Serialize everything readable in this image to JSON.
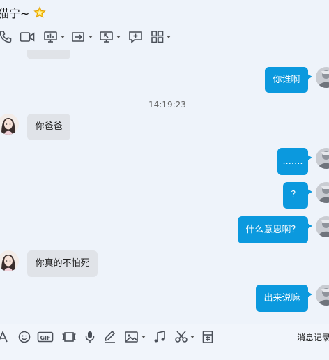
{
  "header": {
    "contact_name": "猫宁~",
    "badge_icon": "star-badge-icon"
  },
  "toolbar_top": {
    "icons": [
      "phone-icon",
      "video-icon",
      "screen-share-icon",
      "file-transfer-icon",
      "remote-desktop-icon",
      "add-chat-icon",
      "apps-grid-icon"
    ]
  },
  "chat": {
    "timestamp": "14:19:23",
    "messages": [
      {
        "side": "in",
        "text": ""
      },
      {
        "side": "out",
        "text": "你谁啊"
      },
      {
        "side": "in",
        "text": "你爸爸"
      },
      {
        "side": "out",
        "text": "......."
      },
      {
        "side": "out",
        "text": "？"
      },
      {
        "side": "out",
        "text": "什么意思啊？"
      },
      {
        "side": "in",
        "text": "你真的不怕死"
      },
      {
        "side": "out",
        "text": "出来说嘛"
      }
    ]
  },
  "toolbar_bottom": {
    "icons": [
      "font-icon",
      "emoji-icon",
      "gif-icon",
      "screenshot-icon",
      "microphone-icon",
      "pen-icon",
      "image-icon",
      "music-icon",
      "scissors-icon",
      "red-packet-icon"
    ],
    "history_label": "消息记录"
  },
  "colors": {
    "background": "#eef3fa",
    "outgoing_bubble": "#0b99de",
    "incoming_bubble": "#e0e3e8"
  }
}
